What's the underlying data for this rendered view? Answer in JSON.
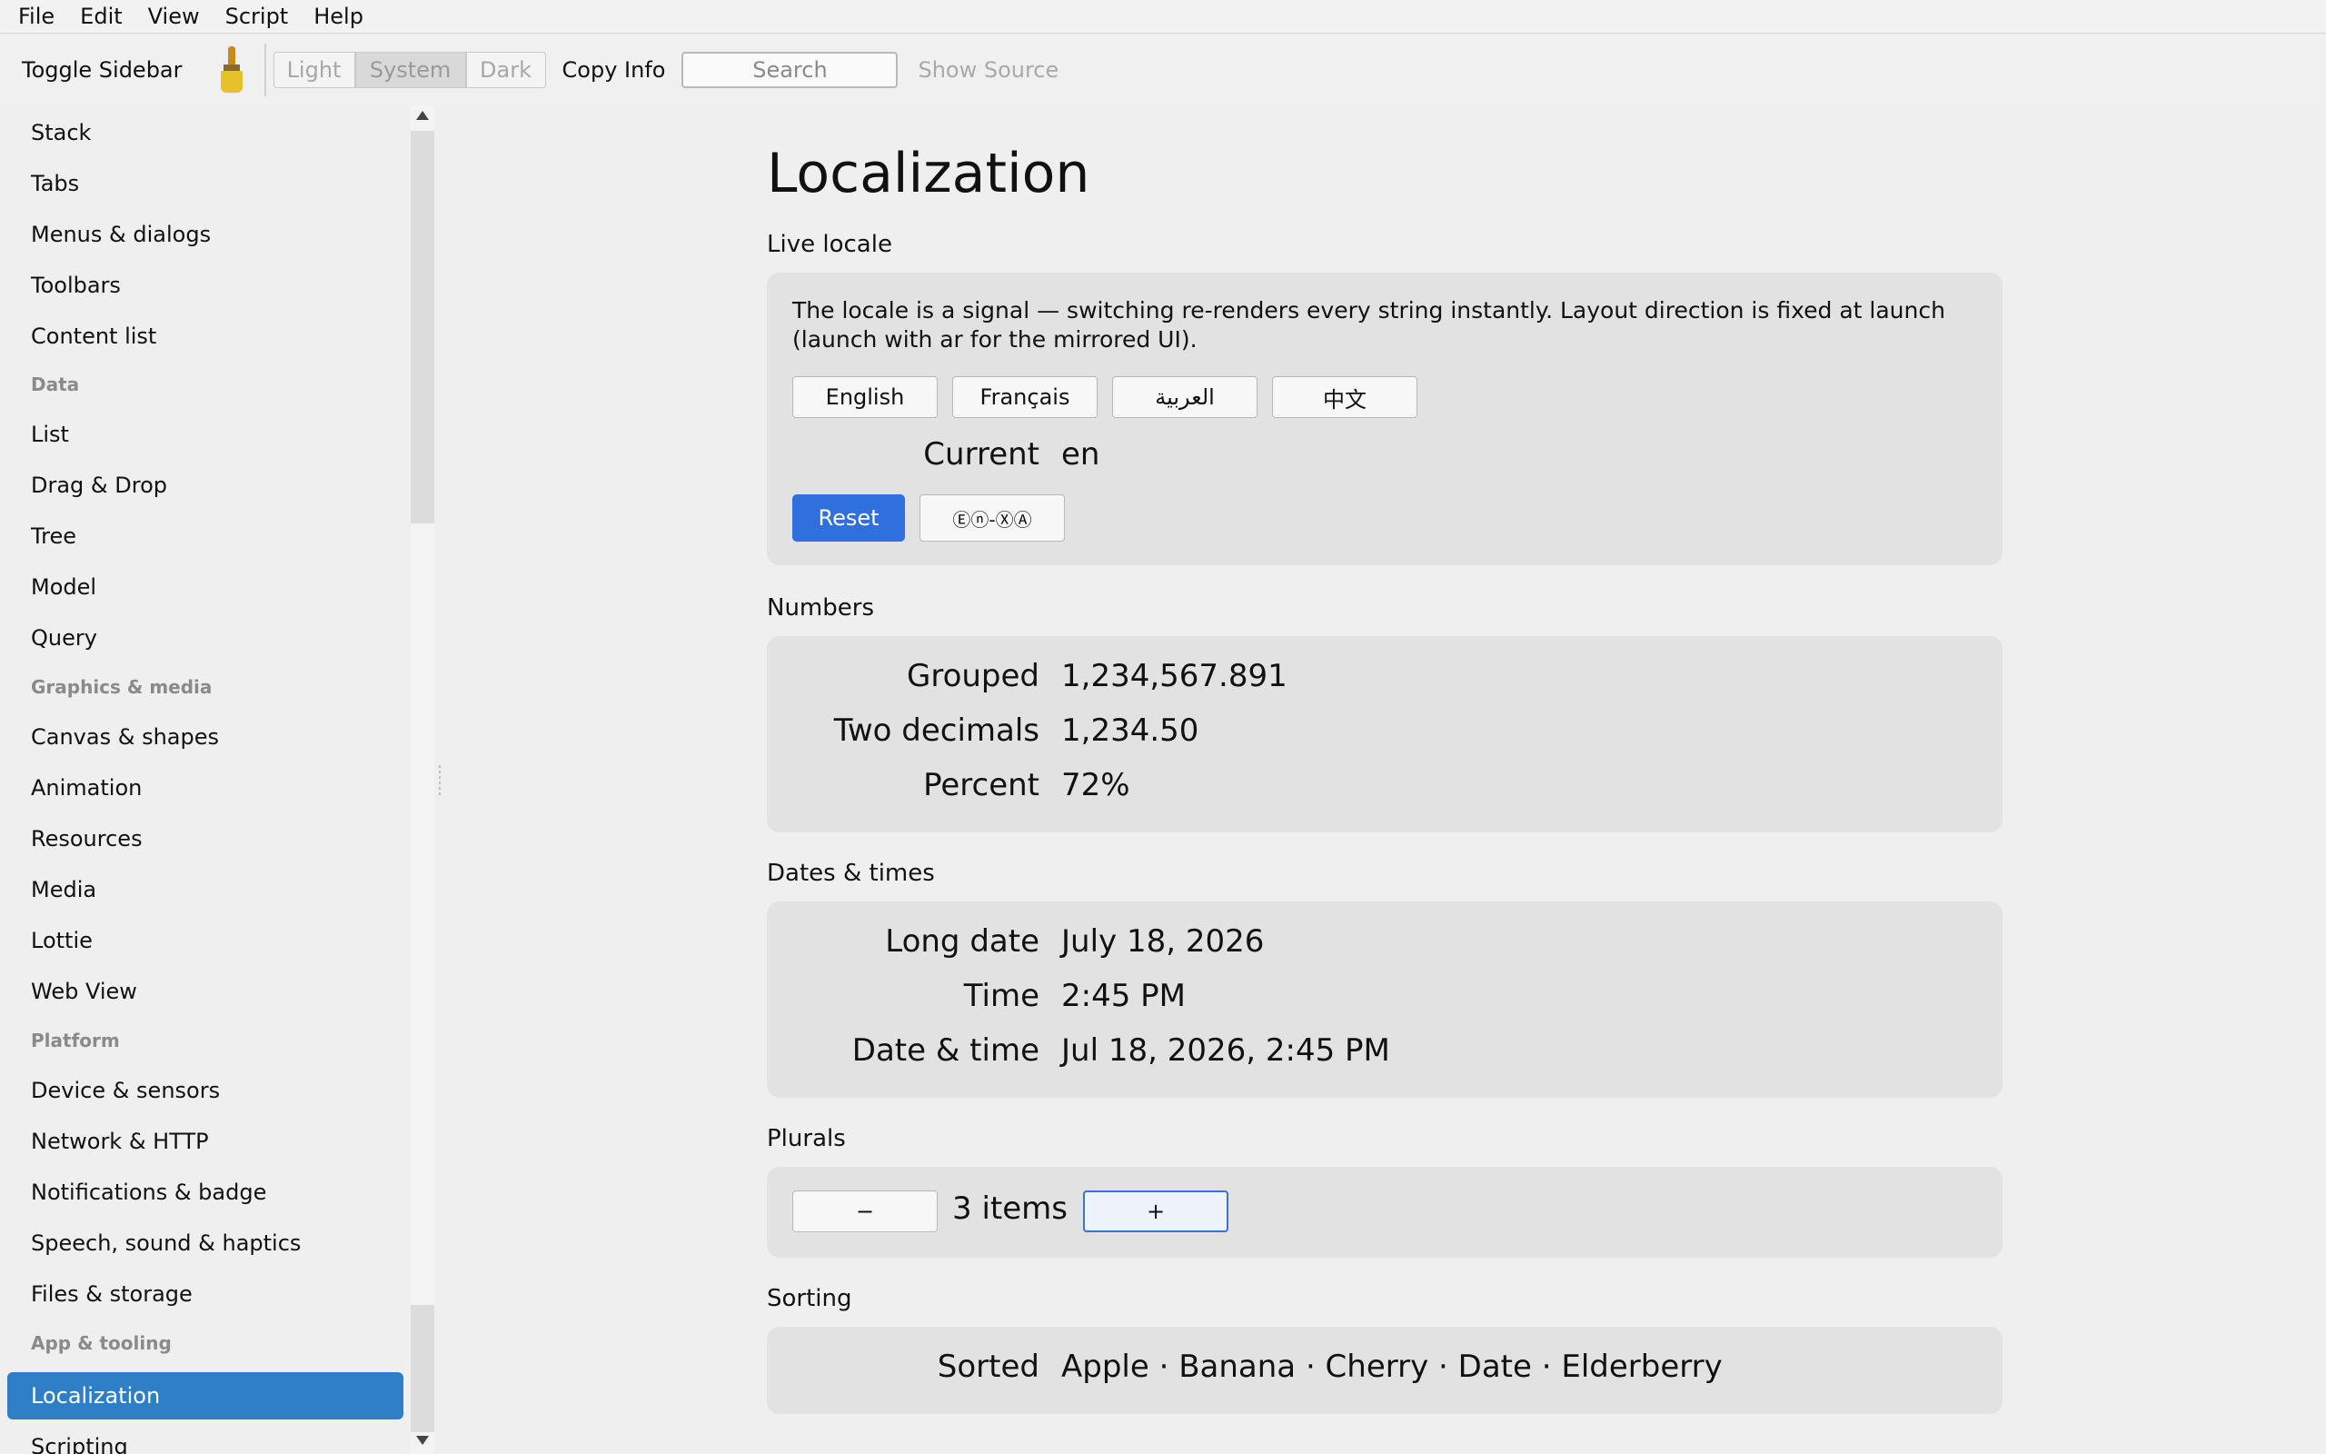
{
  "menu": [
    "File",
    "Edit",
    "View",
    "Script",
    "Help"
  ],
  "toolbar": {
    "toggle_sidebar": "Toggle Sidebar",
    "theme": {
      "light": "Light",
      "system": "System",
      "dark": "Dark"
    },
    "copy_info": "Copy Info",
    "search_placeholder": "Search",
    "show_source": "Show Source"
  },
  "sidebar": {
    "items": [
      "Stack",
      "Tabs",
      "Menus & dialogs",
      "Toolbars",
      "Content list"
    ],
    "section_data": "Data",
    "data_items": [
      "List",
      "Drag & Drop",
      "Tree",
      "Model",
      "Query"
    ],
    "section_graphics": "Graphics & media",
    "graphics_items": [
      "Canvas & shapes",
      "Animation",
      "Resources",
      "Media",
      "Lottie",
      "Web View"
    ],
    "section_platform": "Platform",
    "platform_items": [
      "Device & sensors",
      "Network & HTTP",
      "Notifications & badge",
      "Speech, sound & haptics",
      "Files & storage"
    ],
    "section_app": "App & tooling",
    "app_items": [
      "Localization",
      "Scripting"
    ]
  },
  "page": {
    "title": "Localization",
    "live_locale": {
      "label": "Live locale",
      "description": "The locale is a signal — switching re-renders every string instantly. Layout direction is fixed at launch (launch with ar for the mirrored UI).",
      "languages": [
        "English",
        "Français",
        "العربية",
        "中文"
      ],
      "current_label": "Current",
      "current_value": "en",
      "reset": "Reset",
      "pseudo": "Ⓔⓝ-ⓍⒶ"
    },
    "numbers": {
      "label": "Numbers",
      "rows": [
        {
          "k": "Grouped",
          "v": "1,234,567.891"
        },
        {
          "k": "Two decimals",
          "v": "1,234.50"
        },
        {
          "k": "Percent",
          "v": "72%"
        }
      ]
    },
    "dates": {
      "label": "Dates & times",
      "rows": [
        {
          "k": "Long date",
          "v": "July 18, 2026"
        },
        {
          "k": "Time",
          "v": "2:45 PM"
        },
        {
          "k": "Date & time",
          "v": "Jul 18, 2026, 2:45 PM"
        }
      ]
    },
    "plurals": {
      "label": "Plurals",
      "minus": "−",
      "count": "3 items",
      "plus": "+"
    },
    "sorting": {
      "label": "Sorting",
      "key": "Sorted",
      "value": "Apple · Banana · Cherry · Date · Elderberry"
    }
  },
  "colors": {
    "accent": "#2f7fc6",
    "primary_button": "#2f6fde"
  }
}
